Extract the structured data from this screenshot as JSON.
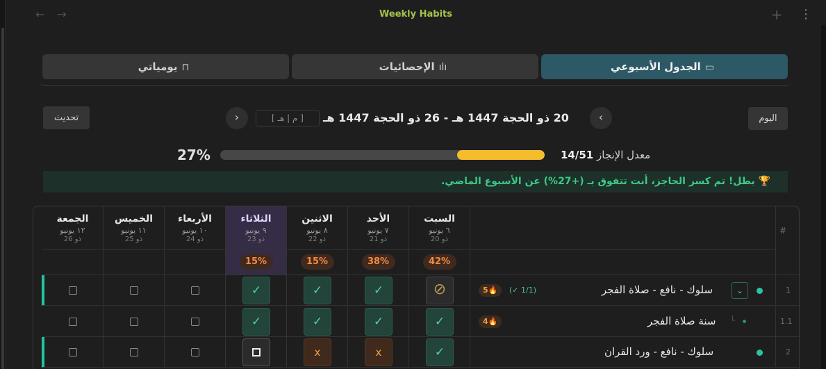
{
  "window": {
    "title": "Weekly Habits",
    "back_glyph": "←",
    "forward_glyph": "→",
    "add_glyph": "+",
    "more_glyph": "⋮"
  },
  "tabs": [
    {
      "label": "الجدول الأسبوعي",
      "icon": "calendar-icon",
      "glyph": "📅",
      "active": true
    },
    {
      "label": "الإحصائيات",
      "icon": "bar-chart-icon",
      "glyph": "📊",
      "active": false
    },
    {
      "label": "يومياتي",
      "icon": "book-icon",
      "glyph": "📖",
      "active": false
    }
  ],
  "toolbar": {
    "today_label": "اليوم",
    "refresh_label": "تحديث",
    "prev_glyph": "‹",
    "next_glyph": "›",
    "date_range": "20 ذو الحجة 1447 هـ - 26 ذو الحجة 1447 هـ",
    "mode_toggle": "[ م | هـ ]"
  },
  "completion": {
    "label": "معدل الإنجاز",
    "count": "14/51",
    "percent_text": "27%",
    "fraction": 0.27,
    "fill_color": "#f5bd2b"
  },
  "banner": {
    "text": "🏆 بطل! تم كسر الحاجز، أنت تتفوق بـ (+27%) عن الأسبوع الماضي."
  },
  "table": {
    "hash_label": "#",
    "days": [
      {
        "name": "السبت",
        "greg": "٦ يونيو",
        "hijri": "20 ذو",
        "pct": "42%",
        "today": false
      },
      {
        "name": "الأحد",
        "greg": "٧ يونيو",
        "hijri": "21 ذو",
        "pct": "38%",
        "today": false
      },
      {
        "name": "الاثنين",
        "greg": "٨ يونيو",
        "hijri": "22 ذو",
        "pct": "15%",
        "today": false
      },
      {
        "name": "الثلاثاء",
        "greg": "٩ يونيو",
        "hijri": "23 ذو",
        "pct": "15%",
        "today": true
      },
      {
        "name": "الأربعاء",
        "greg": "١٠ يونيو",
        "hijri": "24 ذو",
        "pct": "",
        "today": false
      },
      {
        "name": "الخميس",
        "greg": "١١ يونيو",
        "hijri": "25 ذو",
        "pct": "",
        "today": false
      },
      {
        "name": "الجمعة",
        "greg": "١٢ يونيو",
        "hijri": "26 ذو",
        "pct": "",
        "today": false
      }
    ],
    "rows": [
      {
        "num": "1",
        "name": "سلوك - نافع - صلاة الفجر",
        "streak": "5🔥",
        "subcount": "(✓ 1/1)",
        "expand_glyph": "⌄",
        "states": [
          "skip",
          "done",
          "done",
          "done",
          "empty",
          "empty",
          "empty"
        ]
      },
      {
        "num": "1.1",
        "name": "سنة صلاة الفجر",
        "streak": "4🔥",
        "tree_glyph": "└",
        "states": [
          "done",
          "done",
          "done",
          "done",
          "empty",
          "empty",
          "empty"
        ]
      },
      {
        "num": "2",
        "name": "سلوك - نافع - ورد القران",
        "states": [
          "done",
          "miss",
          "miss",
          "pending",
          "empty",
          "empty",
          "empty"
        ]
      }
    ],
    "glyphs": {
      "done": "✓",
      "miss": "x",
      "skip": "⊘"
    }
  }
}
